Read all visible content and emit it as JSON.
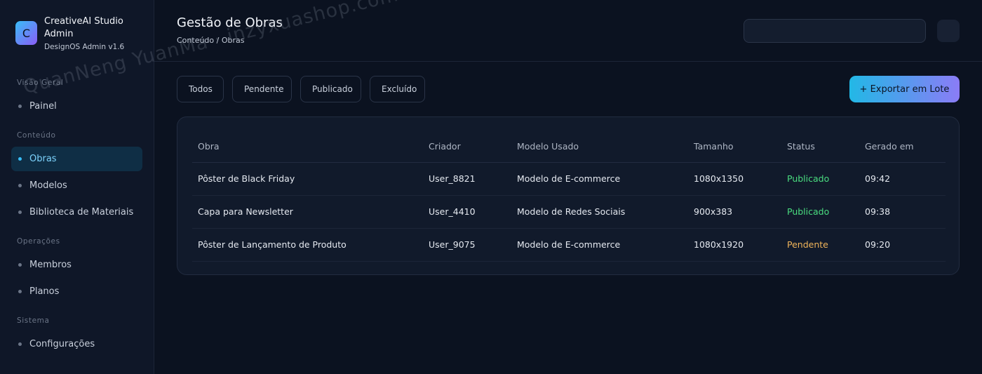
{
  "brand": {
    "logo_letter": "C",
    "name": "CreativeAI Studio Admin",
    "version": "DesignOS Admin v1.6"
  },
  "sidebar": {
    "sections": [
      {
        "label": "Visão Geral",
        "items": [
          {
            "label": "Painel"
          }
        ]
      },
      {
        "label": "Conteúdo",
        "items": [
          {
            "label": "Obras",
            "active": true
          },
          {
            "label": "Modelos"
          },
          {
            "label": "Biblioteca de Materiais"
          }
        ]
      },
      {
        "label": "Operações",
        "items": [
          {
            "label": "Membros"
          },
          {
            "label": "Planos"
          }
        ]
      },
      {
        "label": "Sistema",
        "items": [
          {
            "label": "Configurações"
          }
        ]
      }
    ]
  },
  "header": {
    "title": "Gestão de Obras",
    "breadcrumb": "Conteúdo / Obras",
    "search_value": ""
  },
  "filters": [
    "Todos",
    "Pendente",
    "Publicado",
    "Excluído"
  ],
  "actions": {
    "export_label": "+ Exportar em Lote"
  },
  "table": {
    "columns": [
      "Obra",
      "Criador",
      "Modelo Usado",
      "Tamanho",
      "Status",
      "Gerado em"
    ],
    "rows": [
      [
        "Pôster de Black Friday",
        "User_8821",
        "Modelo de E-commerce",
        "1080x1350",
        "Publicado",
        "09:42"
      ],
      [
        "Capa para Newsletter",
        "User_4410",
        "Modelo de Redes Sociais",
        "900x383",
        "Publicado",
        "09:38"
      ],
      [
        "Pôster de Lançamento de Produto",
        "User_9075",
        "Modelo de E-commerce",
        "1080x1920",
        "Pendente",
        "09:20"
      ]
    ]
  },
  "watermark": "QuanNeng YuanMa · inzyxuashop.com",
  "colors": {
    "accent": "#38bdf8",
    "status_published": "#4ade80",
    "status_pending": "#f0b45a"
  }
}
